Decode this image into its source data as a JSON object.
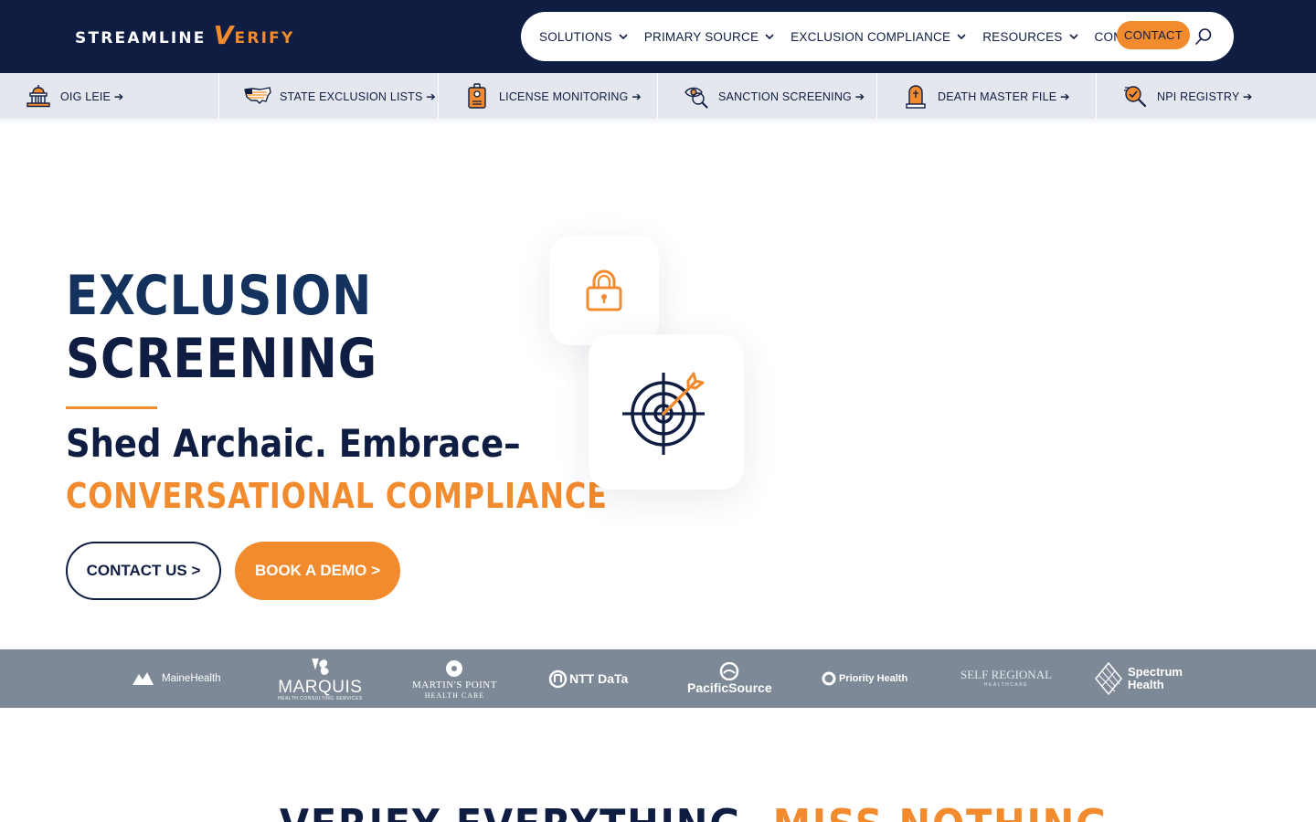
{
  "brand": {
    "logo_main": "STREAMLINE",
    "logo_v": "V",
    "logo_rest": "ERIFY"
  },
  "nav": {
    "items": [
      {
        "label": "SOLUTIONS"
      },
      {
        "label": "PRIMARY SOURCE"
      },
      {
        "label": "EXCLUSION COMPLIANCE"
      },
      {
        "label": "RESOURCES"
      },
      {
        "label": "COMPANY"
      }
    ],
    "contact_label": "CONTACT",
    "icons": {
      "dropdown": "chevron-down-icon",
      "search": "search-icon"
    }
  },
  "subnav": {
    "items": [
      {
        "label": "OIG LEIE ➔",
        "icon": "capitol-building-icon"
      },
      {
        "label": "STATE EXCLUSION LISTS ➔",
        "icon": "us-map-icon"
      },
      {
        "label": "LICENSE MONITORING ➔",
        "icon": "id-badge-icon"
      },
      {
        "label": "SANCTION SCREENING ➔",
        "icon": "eye-magnifier-icon"
      },
      {
        "label": "DEATH MASTER FILE ➔",
        "icon": "tombstone-icon"
      },
      {
        "label": "NPI REGISTRY ➔",
        "icon": "magnifier-check-icon"
      }
    ]
  },
  "hero": {
    "title_line1": "EXCLUSION",
    "title_line2": "SCREENING",
    "subtitle": "Shed Archaic. Embrace–",
    "tagline": "CONVERSATIONAL COMPLIANCE",
    "cta_contact": "CONTACT US >",
    "cta_demo": "BOOK A DEMO >"
  },
  "partners": {
    "maine": "MaineHealth",
    "marquis": "MARQUIS",
    "marquis_sub": "HEALTH CONSULTING SERVICES",
    "martins": "MARTIN'S POINT",
    "martins_sub": "HEALTH CARE",
    "ntt": "NTT DaTa",
    "pacific": "PacificSource",
    "priority": "Priority Health",
    "self": "SELF REGIONAL",
    "self_sub": "HEALTHCARE",
    "spectrum1": "Spectrum",
    "spectrum2": "Health"
  },
  "section": {
    "heading_dark": "VERIFY EVERYTHING.",
    "heading_orange": "MISS NOTHING."
  },
  "colors": {
    "navy": "#0f1d42",
    "orange": "#f28a2e",
    "strip": "#7d8996",
    "subnav": "#e4e8ee"
  }
}
